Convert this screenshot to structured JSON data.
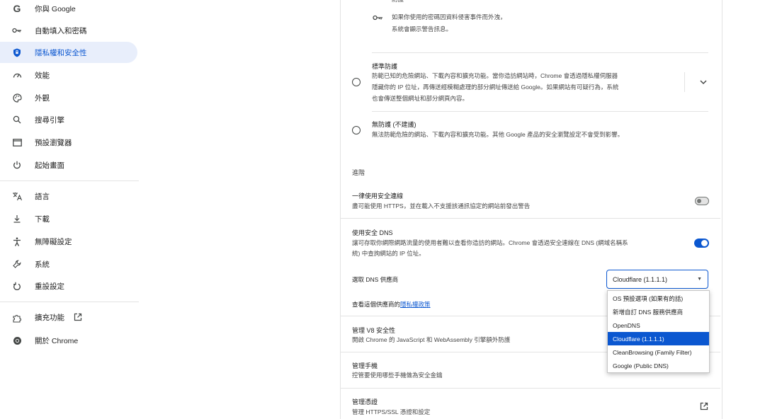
{
  "sidebar": {
    "items": [
      {
        "label": "你與 Google",
        "icon": "google-g-icon",
        "glyph": "G"
      },
      {
        "label": "自動填入和密碼",
        "icon": "key-icon",
        "glyph": "⚿"
      },
      {
        "label": "隱私權和安全性",
        "icon": "shield-icon",
        "glyph": "⛊"
      },
      {
        "label": "效能",
        "icon": "speedometer-icon",
        "glyph": "◔"
      },
      {
        "label": "外觀",
        "icon": "palette-icon",
        "glyph": "❂"
      },
      {
        "label": "搜尋引擎",
        "icon": "search-icon",
        "glyph": "⚲"
      },
      {
        "label": "預設瀏覽器",
        "icon": "browser-icon",
        "glyph": "▭"
      },
      {
        "label": "起始畫面",
        "icon": "power-icon",
        "glyph": "⏻"
      },
      {
        "label": "語言",
        "icon": "translate-icon",
        "glyph": "文"
      },
      {
        "label": "下載",
        "icon": "download-icon",
        "glyph": "⤓"
      },
      {
        "label": "無障礙設定",
        "icon": "accessibility-icon",
        "glyph": "♿"
      },
      {
        "label": "系統",
        "icon": "wrench-icon",
        "glyph": "⚒"
      },
      {
        "label": "重設設定",
        "icon": "reset-icon",
        "glyph": "↺"
      },
      {
        "label": "擴充功能",
        "icon": "puzzle-icon",
        "glyph": "⧉"
      },
      {
        "label": "關於 Chrome",
        "icon": "chrome-icon",
        "glyph": "◉"
      }
    ],
    "active_index": 2
  },
  "main": {
    "top_cut_text": "防護",
    "password_warning": {
      "line1": "如果你使用的密碼因資料侵害事件而外洩，",
      "line2": "系統會顯示警告訊息。"
    },
    "standard": {
      "title": "標準防護",
      "line1": "防範已知的危險網站、下載內容和擴充功能。當你造訪網站時，Chrome 會透過隱私權伺服器",
      "line2": "隱藏你的 IP 位址，再傳送經模糊處理的部分網址傳送給 Google。如果網站有可疑行為，系統",
      "line3": "也會傳送整個網址和部分網頁內容。"
    },
    "no_protection": {
      "title": "無防護 (不建議)",
      "desc": "無法防範危險的網站、下載內容和擴充功能。其他 Google 產品的安全瀏覽設定不會受到影響。"
    },
    "advanced_heading": "進階",
    "https": {
      "title": "一律使用安全連線",
      "desc": "盡可能使用 HTTPS，並在載入不支援該通訊協定的網站前發出警告",
      "enabled": false
    },
    "secure_dns": {
      "title": "使用安全 DNS",
      "line1": "讓可存取你網際網路流量的使用者難以查看你造訪的網站。Chrome 會透過安全連線在 DNS (網域名稱系",
      "line2": "統) 中查詢網站的 IP 位址。",
      "enabled": true
    },
    "dns_provider": {
      "label": "選取 DNS 供應商",
      "selected": "Cloudflare (1.1.1.1)",
      "options": [
        "OS 預設選項 (如果有的話)",
        "新增自訂 DNS 服務供應商",
        "OpenDNS",
        "Cloudflare (1.1.1.1)",
        "CleanBrowsing (Family Filter)",
        "Google (Public DNS)"
      ],
      "selected_index": 3
    },
    "privacy_policy": {
      "prefix": "查看這個供應商的",
      "link": "隱私權政策"
    },
    "v8": {
      "title": "管理 V8 安全性",
      "desc": "開啟 Chrome 的 JavaScript 和 WebAssembly 引擎額外防護"
    },
    "phones": {
      "title": "管理手機",
      "desc": "控管要使用哪些手機做為安全金鑰"
    },
    "certs": {
      "title": "管理憑證",
      "desc": "管理 HTTPS/SSL 憑證和設定"
    }
  },
  "colors": {
    "accent": "#0b57d0",
    "active_bg": "#e8eefb",
    "divider": "#e3e3e3"
  }
}
